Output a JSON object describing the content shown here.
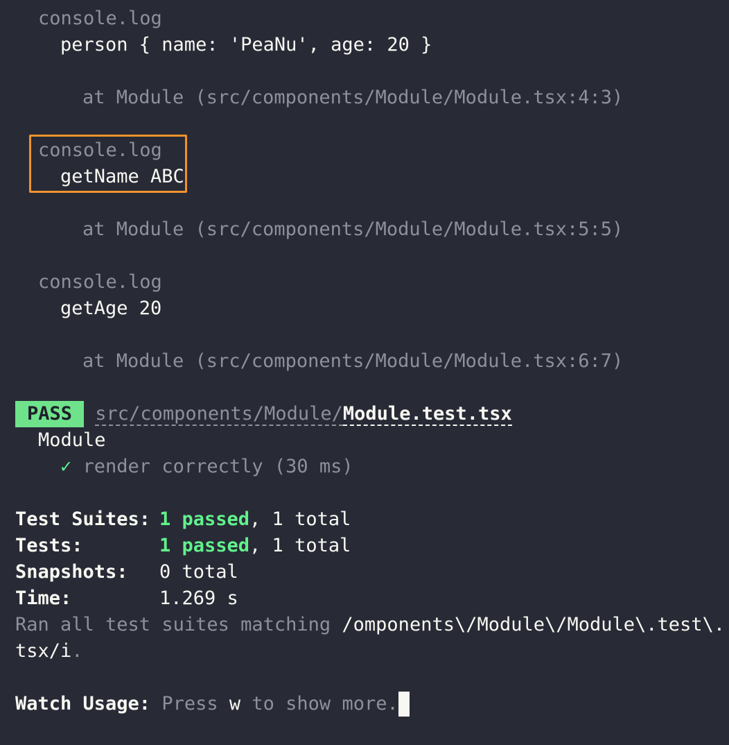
{
  "log_blocks": [
    {
      "header": "console.log",
      "message": "person { name: 'PeaNu', age: 20 }",
      "location": "at Module (src/components/Module/Module.tsx:4:3)"
    },
    {
      "header": "console.log",
      "message": "getName ABC",
      "location": "at Module (src/components/Module/Module.tsx:5:5)",
      "highlighted": true
    },
    {
      "header": "console.log",
      "message": "getAge 20",
      "location": "at Module (src/components/Module/Module.tsx:6:7)"
    }
  ],
  "result": {
    "badge": "PASS",
    "path_dir": "src/components/Module/",
    "path_file": "Module.test.tsx",
    "suite": "Module",
    "check_glyph": "✓",
    "test_name": "render correctly (30 ms)"
  },
  "summary": {
    "suites_label": "Test Suites:",
    "suites_passed": "1 passed",
    "suites_total": ", 1 total",
    "tests_label": "Tests:",
    "tests_passed": "1 passed",
    "tests_total": ", 1 total",
    "snapshots_label": "Snapshots:",
    "snapshots_value": "0 total",
    "time_label": "Time:",
    "time_value": "1.269 s",
    "ran_prefix": "Ran all test suites matching ",
    "ran_pattern_1": "/omponents\\/Module\\/Module\\.test\\.",
    "ran_pattern_2": "tsx/i",
    "ran_suffix": "."
  },
  "watch": {
    "label": "Watch Usage:",
    "press": " Press ",
    "key": "w",
    "rest": " to show more."
  },
  "colors": {
    "background": "#282a36",
    "pass_badge": "#6fe38c",
    "passed_text": "#61f28c",
    "highlight_border": "#f0932b",
    "dim_text": "#8e909a"
  }
}
